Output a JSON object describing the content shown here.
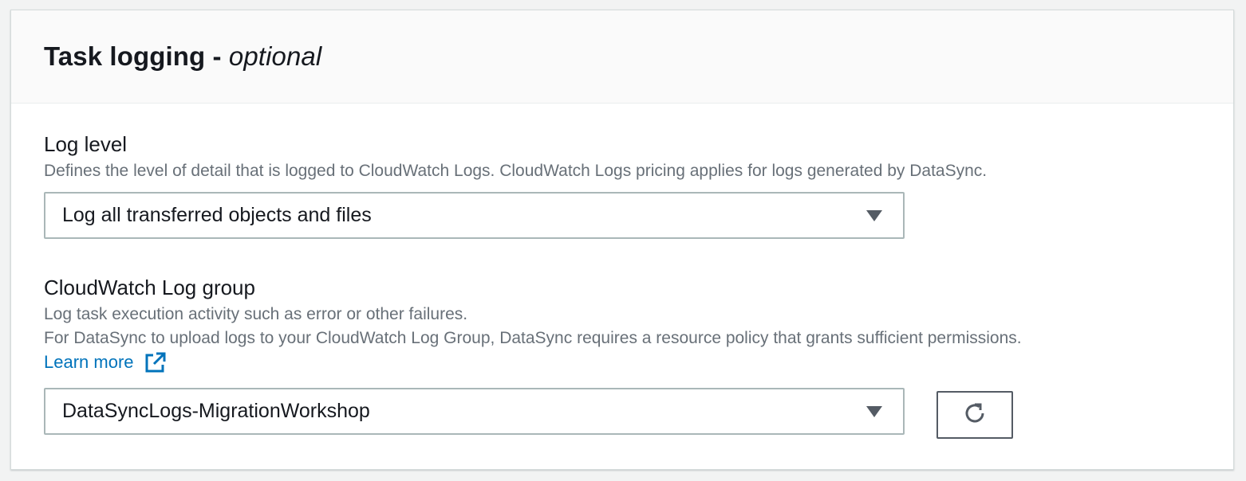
{
  "panel": {
    "title": "Task logging - ",
    "title_optional": "optional"
  },
  "log_level": {
    "label": "Log level",
    "description": "Defines the level of detail that is logged to CloudWatch Logs. CloudWatch Logs pricing applies for logs generated by DataSync.",
    "selected": "Log all transferred objects and files"
  },
  "log_group": {
    "label": "CloudWatch Log group",
    "description_line1": "Log task execution activity such as error or other failures.",
    "description_line2": "For DataSync to upload logs to your CloudWatch Log Group, DataSync requires a resource policy that grants sufficient permissions.",
    "learn_more": "Learn more",
    "selected": "DataSyncLogs-MigrationWorkshop",
    "refresh_icon": "refresh-icon",
    "external_link_icon": "external-link-icon"
  },
  "colors": {
    "link": "#0073bb",
    "description": "#687078",
    "border": "#aab7b8"
  }
}
